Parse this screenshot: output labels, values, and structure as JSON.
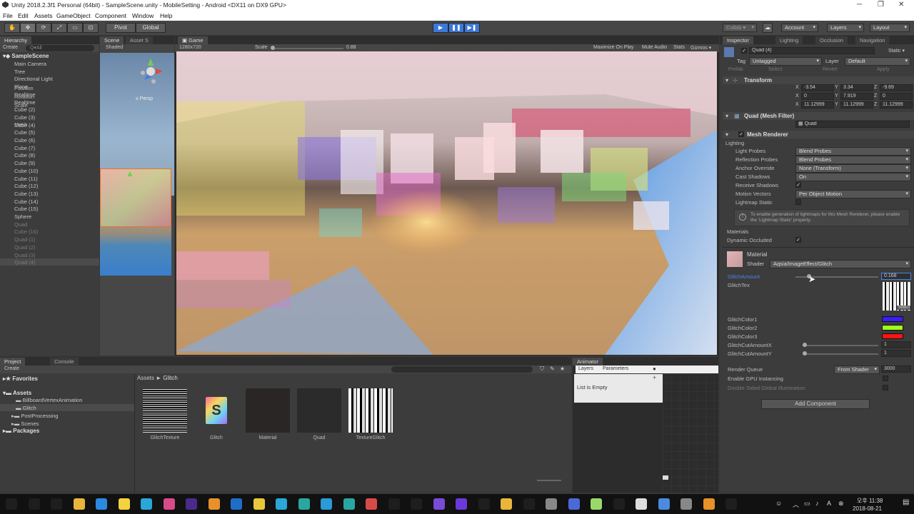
{
  "window": {
    "title": "Unity 2018.2.3f1 Personal (64bit) - SampleScene.unity - MobileSetting - Android <DX11 on DX9 GPU>"
  },
  "menu": [
    "File",
    "Edit",
    "Assets",
    "GameObject",
    "Component",
    "Window",
    "Help"
  ],
  "toolbar": {
    "pivot": "Pivot",
    "global": "Global",
    "collab": "Collab ▾",
    "account": "Account",
    "layers": "Layers",
    "layout": "Layout"
  },
  "hierarchy": {
    "tab": "Hierarchy",
    "create": "Create",
    "search_placeholder": "Q▾All",
    "scene": "SampleScene",
    "items": [
      {
        "label": "Main Camera",
        "dim": false
      },
      {
        "label": "Tree",
        "dim": false
      },
      {
        "label": "Directional Light",
        "dim": false
      },
      {
        "label": "Plane",
        "dim": false
      },
      {
        "label": "Realtime",
        "dim": false
      },
      {
        "label": "Realtime",
        "dim": false
      },
      {
        "label": "Cube (2)",
        "dim": false
      },
      {
        "label": "Cube (3)",
        "dim": false
      },
      {
        "label": "Cube (4)",
        "dim": false
      },
      {
        "label": "Cube (5)",
        "dim": false
      },
      {
        "label": "Cube (6)",
        "dim": false
      },
      {
        "label": "Cube (7)",
        "dim": false
      },
      {
        "label": "Cube (8)",
        "dim": false
      },
      {
        "label": "Cube (9)",
        "dim": false
      },
      {
        "label": "Cube (10)",
        "dim": false
      },
      {
        "label": "Cube (11)",
        "dim": false
      },
      {
        "label": "Cube (12)",
        "dim": false
      },
      {
        "label": "Cube (13)",
        "dim": false
      },
      {
        "label": "Cube (14)",
        "dim": false
      },
      {
        "label": "Cube (15)",
        "dim": false
      },
      {
        "label": "Sphere",
        "dim": false
      },
      {
        "label": "Quad",
        "dim": true
      },
      {
        "label": "Cube (16)",
        "dim": true
      },
      {
        "label": "Quad (1)",
        "dim": true
      },
      {
        "label": "Quad (2)",
        "dim": true
      },
      {
        "label": "Quad (3)",
        "dim": true
      },
      {
        "label": "Quad (4)",
        "dim": true
      }
    ]
  },
  "scene": {
    "tab": "Scene",
    "asset_tab": "Asset S",
    "shaded": "Shaded",
    "persp": "≤ Persp"
  },
  "game": {
    "tab": "Game",
    "resolution": "1280x720",
    "scale_label": "Scale",
    "scale_value": "0.88",
    "buttons": [
      "Maximize On Play",
      "Mute Audio",
      "Stats",
      "Gizmos ▾"
    ]
  },
  "inspector": {
    "tabs": [
      "Inspector",
      "Lighting",
      "Occlusion",
      "Navigation"
    ],
    "object_name": "Quad (4)",
    "static": "Static ▾",
    "tag_label": "Tag",
    "tag_value": "Untagged",
    "layer_label": "Layer",
    "layer_value": "Default",
    "prefab": "Prefab",
    "select": "Select",
    "revert": "Revert",
    "apply": "Apply",
    "transform": {
      "title": "Transform",
      "position_label": "Position",
      "position": [
        "-3.54",
        "3.34",
        "-9.69"
      ],
      "rotation_label": "Rotation",
      "rotation": [
        "0",
        "7.919",
        "0"
      ],
      "scale_label": "Scale",
      "scale": [
        "11.12999",
        "11.12999",
        "11.12999"
      ]
    },
    "mesh_filter": {
      "title": "Quad (Mesh Filter)",
      "mesh_label": "Mesh",
      "mesh_value": "Quad"
    },
    "mesh_renderer": {
      "title": "Mesh Renderer",
      "lighting": "Lighting",
      "rows": [
        {
          "label": "Light Probes",
          "value": "Blend Probes"
        },
        {
          "label": "Reflection Probes",
          "value": "Blend Probes"
        },
        {
          "label": "Anchor Override",
          "value": "None (Transform)"
        },
        {
          "label": "Cast Shadows",
          "value": "On"
        }
      ],
      "receive_shadows": "Receive Shadows",
      "motion_vectors": "Motion Vectors",
      "motion_vectors_value": "Per Object Motion",
      "lightmap_static": "Lightmap Static",
      "info": "To enable generation of lightmaps for this Mesh Renderer, please enable the 'Lightmap Static' property.",
      "materials": "Materials",
      "dynamic_occluded": "Dynamic Occluded"
    },
    "material": {
      "title": "Material",
      "shader_label": "Shader",
      "shader_value": "Aqsia/ImageEffect/Glitch",
      "props": {
        "glitch_amount": "GlitchAmount",
        "glitch_amount_value": "0.168",
        "glitch_tex": "GlitchTex",
        "select": "Select",
        "color1": "GlitchColor1",
        "color2": "GlitchColor2",
        "color3": "GlitchColor3",
        "cut_x": "GlitchCutAmountX",
        "cut_x_value": "1",
        "cut_y": "GlitchCutAmountY",
        "cut_y_value": "1"
      },
      "glitch_amount_fraction": 0.168,
      "render_queue": "Render Queue",
      "render_queue_mode": "From Shader",
      "render_queue_value": "3000",
      "gpu_instancing": "Enable GPU Instancing",
      "double_sided": "Double Sided Global Illumination"
    },
    "add_component": "Add Component",
    "colors": {
      "color1": "#3a1cff",
      "color2": "#9dff1a",
      "color3": "#ff1414"
    }
  },
  "project": {
    "tab": "Project",
    "console_tab": "Console",
    "create": "Create",
    "favorites": "Favorites",
    "assets": "Assets",
    "tree": [
      "BillboardVertexAnimation",
      "Glitch",
      "PostProcessing",
      "Scenes"
    ],
    "packages": "Packages",
    "breadcrumb_root": "Assets",
    "breadcrumb_sep": "►",
    "breadcrumb_leaf": "Glitch",
    "items": [
      "GlitchTexture",
      "Glitch",
      "Material",
      "Quad",
      "TextureGlitch"
    ]
  },
  "animator": {
    "tab": "Animator",
    "layers": "Layers",
    "parameters": "Parameters",
    "empty": "List is Empty"
  },
  "taskbar": {
    "clock_time": "오후 11:38",
    "clock_date": "2018-08-21",
    "icons": [
      "windows-icon",
      "search-icon",
      "taskview-icon",
      "explorer-icon",
      "chrome-icon",
      "kakaotalk-icon",
      "app-icon",
      "indesign-icon",
      "aftereffects-icon",
      "illustrator-icon",
      "photoshop-icon",
      "app-m-icon",
      "app-icon",
      "app-icon",
      "app-3-icon",
      "app-m-icon",
      "app-icon",
      "app-icon",
      "app-icon",
      "app-icon",
      "visualstudio-icon",
      "app-icon",
      "app-icon",
      "app-icon",
      "app-icon",
      "app-icon",
      "app-icon",
      "app-icon",
      "app-icon",
      "app-icon",
      "app-icon",
      "app-icon",
      "unity-icon"
    ]
  }
}
